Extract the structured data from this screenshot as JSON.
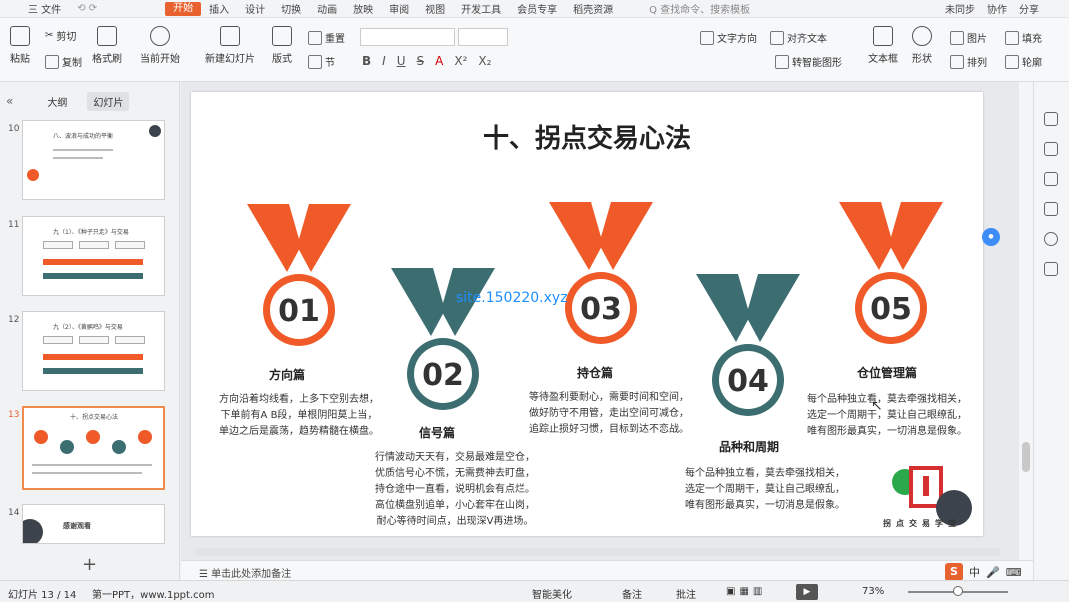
{
  "topbar": {
    "menus": [
      {
        "label": "三 文件",
        "active": false
      },
      {
        "label": "开始",
        "active": true
      },
      {
        "label": "插入",
        "active": false
      },
      {
        "label": "设计",
        "active": false
      },
      {
        "label": "切换",
        "active": false
      },
      {
        "label": "动画",
        "active": false
      },
      {
        "label": "放映",
        "active": false
      },
      {
        "label": "审阅",
        "active": false
      },
      {
        "label": "视图",
        "active": false
      },
      {
        "label": "开发工具",
        "active": false
      },
      {
        "label": "会员专享",
        "active": false
      },
      {
        "label": "稻壳资源",
        "active": false
      }
    ],
    "search_placeholder": "Q 查找命令、搜索模板",
    "right_items": [
      "未同步",
      "协作",
      "分享"
    ]
  },
  "ribbon": {
    "paste": "粘贴",
    "cut": "剪切",
    "copy": "复制",
    "format_painter": "格式刷",
    "start_from_current": "当前开始",
    "new_slide": "新建幻灯片",
    "layout": "版式",
    "reset": "重置",
    "section": "节",
    "text_direction": "文字方向",
    "align_text": "对齐文本",
    "convert_smartart": "转智能图形",
    "textbox": "文本框",
    "shape": "形状",
    "picture": "图片",
    "arrange": "排列",
    "fill": "填充",
    "outline": "轮廓",
    "format_buttons": [
      "B",
      "I",
      "U",
      "S",
      "A",
      "X²",
      "X₂"
    ]
  },
  "panel": {
    "tab_outline": "大纲",
    "tab_slides": "幻灯片",
    "thumbs": [
      {
        "num": "10",
        "title": "八、波浪与成功的平衡"
      },
      {
        "num": "11",
        "title": "九（1）、《种子只走》与交易"
      },
      {
        "num": "12",
        "title": "九（2）、《黄鹂鸣》与交易"
      },
      {
        "num": "13",
        "title": "十、拐点交易心法"
      },
      {
        "num": "14",
        "title": "感谢观看"
      }
    ],
    "add_slide": "+"
  },
  "slide": {
    "title": "十、拐点交易心法",
    "watermark": "site.150220.xyz",
    "colors": {
      "orange": "#f05a28",
      "teal": "#3c6e71"
    },
    "medals": [
      {
        "num": "01",
        "name": "方向篇",
        "desc": "方向沿着均线看，上多下空别去想，\n下单前有A B段，单根阴阳莫上当，\n单边之后是震荡，趋势精髓在横盘。"
      },
      {
        "num": "02",
        "name": "信号篇",
        "desc": "行情波动天天有，交易最难是空仓，\n优质信号心不慌，无需费神去盯盘，\n持仓途中一直看，说明机会有点烂。\n高位横盘别追单，小心套牢在山岗，\n耐心等待时间点，出现深V再进场。"
      },
      {
        "num": "03",
        "name": "持仓篇",
        "desc": "等待盈利要耐心，需要时间和空间，\n做好防守不用管，走出空间可减仓，\n追踪止损好习惯，目标到达不恋战。"
      },
      {
        "num": "04",
        "name": "品种和周期",
        "desc": "每个品种独立看，莫去牵强找相关，\n选定一个周期干，莫让自己眼缭乱，\n唯有图形最真实，一切消息是假象。"
      },
      {
        "num": "05",
        "name": "仓位管理篇",
        "desc": "每个品种独立看，莫去牵强找相关，\n选定一个周期干，莫让自己眼缭乱，\n唯有图形最真实，一切消息是假象。"
      }
    ],
    "logo_text": "拐点交易学堂"
  },
  "notes_placeholder": "单击此处添加备注",
  "statusbar": {
    "slide_info": "幻灯片 13 / 14",
    "theme": "第一PPT，www.1ppt.com",
    "beautify": "智能美化",
    "notes": "备注",
    "comments": "批注",
    "zoom": "73%"
  },
  "ime": {
    "lang": "中"
  }
}
